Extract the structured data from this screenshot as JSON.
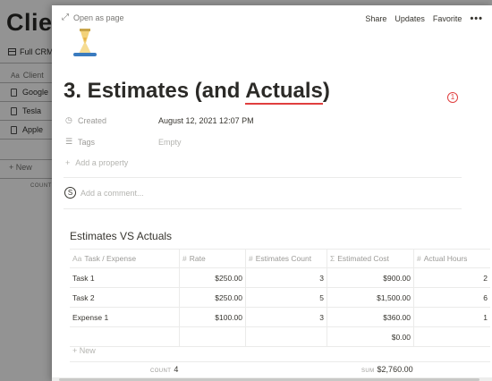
{
  "background": {
    "title": "Clier",
    "view_label": "Full CRM",
    "column_header": "Client",
    "rows": [
      "Google",
      "Tesla",
      "Apple"
    ],
    "new_label": "New",
    "count_label": "COUNT"
  },
  "topbar": {
    "open_as_page": "Open as page",
    "share": "Share",
    "updates": "Updates",
    "favorite": "Favorite",
    "more": "•••"
  },
  "page": {
    "icon": "hourglass-icon",
    "title_prefix": "3. Estimates (and ",
    "title_underlined": "Actuals",
    "title_suffix": ")",
    "badge": "1",
    "properties": [
      {
        "icon": "clock-icon",
        "name": "Created",
        "value": "August 12, 2021 12:07 PM",
        "empty": false
      },
      {
        "icon": "list-icon",
        "name": "Tags",
        "value": "Empty",
        "empty": true
      }
    ],
    "add_property": "Add a property",
    "comment_avatar": "S",
    "comment_placeholder": "Add a comment..."
  },
  "database": {
    "title": "Estimates VS Actuals",
    "columns": [
      {
        "icon": "Aa",
        "label": "Task / Expense"
      },
      {
        "icon": "#",
        "label": "Rate"
      },
      {
        "icon": "#",
        "label": "Estimates Count"
      },
      {
        "icon": "Σ",
        "label": "Estimated Cost"
      },
      {
        "icon": "#",
        "label": "Actual Hours"
      }
    ],
    "rows": [
      [
        "Task 1",
        "$250.00",
        "3",
        "$900.00",
        "2"
      ],
      [
        "Task 2",
        "$250.00",
        "5",
        "$1,500.00",
        "6"
      ],
      [
        "Expense 1",
        "$100.00",
        "3",
        "$360.00",
        "1"
      ],
      [
        "",
        "",
        "",
        "$0.00",
        ""
      ]
    ],
    "new_label": "New",
    "count_label": "COUNT",
    "count_value": "4",
    "sum_label": "SUM",
    "sum_value": "$2,760.00"
  },
  "colors": {
    "accent_red": "#e03e3e",
    "text": "#37352f",
    "muted": "#9b9a97"
  }
}
